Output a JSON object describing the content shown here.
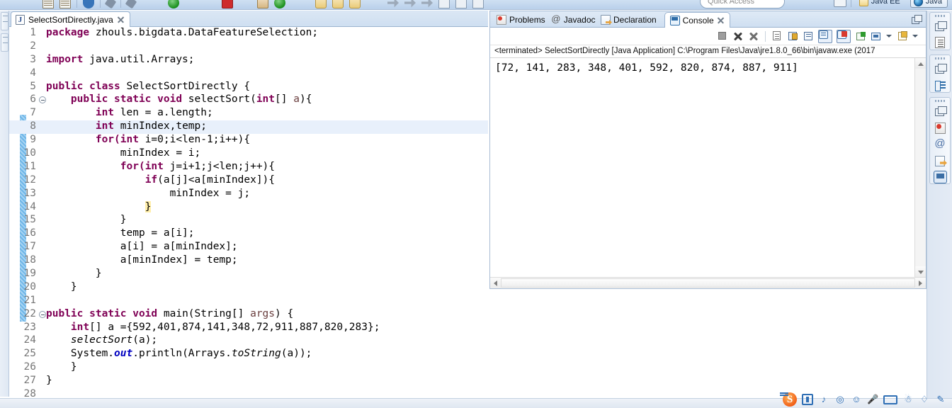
{
  "window": {
    "quick_access_placeholder": "Quick Access",
    "perspectives": [
      {
        "label": "Java EE",
        "icon": "javaee-perspective-icon",
        "active": false
      },
      {
        "label": "Java",
        "icon": "java-perspective-icon",
        "active": true
      }
    ],
    "toolbar_icons": [
      "new-wizard-icon",
      "save-icon",
      "sep",
      "export-icon",
      "sep",
      "build-icon",
      "sep",
      "search-icon",
      "sep",
      "run-icon",
      "sep",
      "terminate-icon",
      "sep",
      "package-icon",
      "debug-icon",
      "sep",
      "open-folder-icon",
      "open-folder-icon",
      "open-type-icon",
      "sep",
      "back-icon",
      "forward-icon",
      "sep",
      "view-icon",
      "view-icon",
      "view-icon"
    ]
  },
  "editor": {
    "tab": {
      "filename": "SelectSortDirectly.java",
      "icon": "java-file-icon",
      "close_icon": "close-icon"
    },
    "current_line": 8,
    "lines": [
      {
        "n": 1,
        "fold": false,
        "tokens": [
          {
            "t": "package ",
            "s": "kw"
          },
          {
            "t": "zhouls.bigdata.DataFeatureSelection;",
            "s": "pl"
          }
        ]
      },
      {
        "n": 2,
        "fold": false,
        "tokens": []
      },
      {
        "n": 3,
        "fold": false,
        "tokens": [
          {
            "t": "import ",
            "s": "kw"
          },
          {
            "t": "java.util.Arrays;",
            "s": "pl"
          }
        ]
      },
      {
        "n": 4,
        "fold": false,
        "tokens": []
      },
      {
        "n": 5,
        "fold": false,
        "tokens": [
          {
            "t": "public class ",
            "s": "kw"
          },
          {
            "t": "SelectSortDirectly {",
            "s": "pl"
          }
        ]
      },
      {
        "n": 6,
        "fold": true,
        "tokens": [
          {
            "t": "    ",
            "s": "pl"
          },
          {
            "t": "public static void ",
            "s": "kw"
          },
          {
            "t": "selectSort(",
            "s": "pl"
          },
          {
            "t": "int",
            "s": "kw"
          },
          {
            "t": "[] ",
            "s": "pl"
          },
          {
            "t": "a",
            "s": "arg"
          },
          {
            "t": "){",
            "s": "pl"
          }
        ]
      },
      {
        "n": 7,
        "fold": false,
        "tokens": [
          {
            "t": "        ",
            "s": "pl"
          },
          {
            "t": "int ",
            "s": "kw"
          },
          {
            "t": "len = a.length;",
            "s": "pl"
          }
        ]
      },
      {
        "n": 8,
        "fold": false,
        "tokens": [
          {
            "t": "        ",
            "s": "pl"
          },
          {
            "t": "int ",
            "s": "kw"
          },
          {
            "t": "minIndex,temp;",
            "s": "pl"
          }
        ]
      },
      {
        "n": 9,
        "fold": false,
        "tokens": [
          {
            "t": "        ",
            "s": "pl"
          },
          {
            "t": "for(",
            "s": "kw"
          },
          {
            "t": "int ",
            "s": "kw"
          },
          {
            "t": "i=0;i<len-1;i++){",
            "s": "pl"
          }
        ]
      },
      {
        "n": 10,
        "fold": false,
        "tokens": [
          {
            "t": "            minIndex = i;",
            "s": "pl"
          }
        ]
      },
      {
        "n": 11,
        "fold": false,
        "tokens": [
          {
            "t": "            ",
            "s": "pl"
          },
          {
            "t": "for(",
            "s": "kw"
          },
          {
            "t": "int ",
            "s": "kw"
          },
          {
            "t": "j=i+1;j<len;j++){",
            "s": "pl"
          }
        ]
      },
      {
        "n": 12,
        "fold": false,
        "tokens": [
          {
            "t": "                ",
            "s": "pl"
          },
          {
            "t": "if",
            "s": "kw"
          },
          {
            "t": "(a[j]<a[minIndex]){",
            "s": "pl"
          }
        ]
      },
      {
        "n": 13,
        "fold": false,
        "tokens": [
          {
            "t": "                    minIndex = j;",
            "s": "pl"
          }
        ]
      },
      {
        "n": 14,
        "fold": false,
        "tokens": [
          {
            "t": "                ",
            "s": "pl"
          },
          {
            "t": "}",
            "s": "brkt"
          }
        ]
      },
      {
        "n": 15,
        "fold": false,
        "tokens": [
          {
            "t": "            }",
            "s": "pl"
          }
        ]
      },
      {
        "n": 16,
        "fold": false,
        "tokens": [
          {
            "t": "            temp = a[i];",
            "s": "pl"
          }
        ]
      },
      {
        "n": 17,
        "fold": false,
        "tokens": [
          {
            "t": "            a[i] = a[minIndex];",
            "s": "pl"
          }
        ]
      },
      {
        "n": 18,
        "fold": false,
        "tokens": [
          {
            "t": "            a[minIndex] = temp;",
            "s": "pl"
          }
        ]
      },
      {
        "n": 19,
        "fold": false,
        "tokens": [
          {
            "t": "        }",
            "s": "pl"
          }
        ]
      },
      {
        "n": 20,
        "fold": false,
        "tokens": [
          {
            "t": "    }",
            "s": "pl"
          }
        ]
      },
      {
        "n": 21,
        "fold": false,
        "tokens": []
      },
      {
        "n": 22,
        "fold": true,
        "tokens": [
          {
            "t": "public static void ",
            "s": "kw"
          },
          {
            "t": "main(String[] ",
            "s": "pl"
          },
          {
            "t": "args",
            "s": "arg"
          },
          {
            "t": ") {",
            "s": "pl"
          }
        ]
      },
      {
        "n": 23,
        "fold": false,
        "tokens": [
          {
            "t": "    ",
            "s": "pl"
          },
          {
            "t": "int",
            "s": "kw"
          },
          {
            "t": "[] a ={592,401,874,141,348,72,911,887,820,283};",
            "s": "pl"
          }
        ]
      },
      {
        "n": 24,
        "fold": false,
        "tokens": [
          {
            "t": "    ",
            "s": "pl"
          },
          {
            "t": "selectSort",
            "s": "mth"
          },
          {
            "t": "(a);",
            "s": "pl"
          }
        ]
      },
      {
        "n": 25,
        "fold": false,
        "tokens": [
          {
            "t": "    System.",
            "s": "pl"
          },
          {
            "t": "out",
            "s": "fld"
          },
          {
            "t": ".println(Arrays.",
            "s": "pl"
          },
          {
            "t": "toString",
            "s": "mth"
          },
          {
            "t": "(a));",
            "s": "pl"
          }
        ]
      },
      {
        "n": 26,
        "fold": false,
        "tokens": [
          {
            "t": "    }",
            "s": "pl"
          }
        ]
      },
      {
        "n": 27,
        "fold": false,
        "tokens": [
          {
            "t": "}",
            "s": "pl"
          }
        ]
      },
      {
        "n": 28,
        "fold": false,
        "tokens": []
      }
    ]
  },
  "console_view": {
    "tabs": [
      {
        "label": "Problems",
        "icon": "problems-icon",
        "active": false,
        "closable": false
      },
      {
        "label": "Javadoc",
        "icon": "javadoc-icon",
        "active": false,
        "closable": false
      },
      {
        "label": "Declaration",
        "icon": "declaration-icon",
        "active": false,
        "closable": false
      },
      {
        "label": "Console",
        "icon": "console-icon",
        "active": true,
        "closable": true
      }
    ],
    "minimize_icon": "minimize-view-icon",
    "toolbar_icons": [
      {
        "name": "terminate-icon",
        "style": "g-term",
        "boxed": false
      },
      {
        "name": "remove-launch-icon",
        "style": "g-x",
        "boxed": false
      },
      {
        "name": "remove-all-launches-icon",
        "style": "g-xx",
        "boxed": false
      },
      {
        "name": "separator",
        "style": "sep",
        "boxed": false
      },
      {
        "name": "clear-console-icon",
        "style": "g-doc",
        "boxed": false
      },
      {
        "name": "scroll-lock-icon",
        "style": "g-lock",
        "boxed": false
      },
      {
        "name": "word-wrap-icon",
        "style": "g-wrap",
        "boxed": false
      },
      {
        "name": "show-console-on-output-icon",
        "style": "g-showc",
        "boxed": true
      },
      {
        "name": "show-console-on-error-icon",
        "style": "g-pinc",
        "boxed": true
      },
      {
        "name": "new-console-view-icon",
        "style": "g-newc",
        "boxed": false
      },
      {
        "name": "display-selected-console-icon",
        "style": "g-disp",
        "boxed": false
      },
      {
        "name": "display-dropdown-icon",
        "style": "drop",
        "boxed": false
      },
      {
        "name": "open-console-icon",
        "style": "g-open",
        "boxed": false
      },
      {
        "name": "open-console-dropdown-icon",
        "style": "drop",
        "boxed": false
      }
    ],
    "status_line": "<terminated> SelectSortDirectly [Java Application] C:\\Program Files\\Java\\jre1.8.0_66\\bin\\javaw.exe (2017",
    "output": "[72, 141, 283, 348, 401, 592, 820, 874, 887, 911]"
  },
  "right_trim": {
    "stacks": [
      {
        "items": [
          {
            "name": "restore-view-icon",
            "style": "rvi-restore"
          },
          {
            "name": "outline-view-icon",
            "style": "rvi-outline"
          }
        ]
      },
      {
        "items": [
          {
            "name": "restore-view-icon",
            "style": "rvi-restore"
          },
          {
            "name": "package-explorer-icon",
            "style": "rvi-pkg"
          }
        ]
      },
      {
        "items": [
          {
            "name": "restore-view-icon",
            "style": "rvi-restore"
          },
          {
            "name": "problems-view-icon",
            "style": "rvi-prob"
          },
          {
            "name": "javadoc-view-icon",
            "style": "rvi-jdoc"
          },
          {
            "name": "declaration-view-icon",
            "style": "rvi-decl"
          },
          {
            "name": "console-view-icon",
            "style": "rvi-cons-sel"
          }
        ]
      }
    ]
  },
  "ime_bar": {
    "icons": [
      "sogou-logo-icon",
      "toolbox-icon",
      "music-icon",
      "skin-icon",
      "emoji-icon",
      "voice-input-icon",
      "soft-keyboard-icon",
      "user-icon",
      "shirt-icon",
      "pen-icon"
    ]
  }
}
